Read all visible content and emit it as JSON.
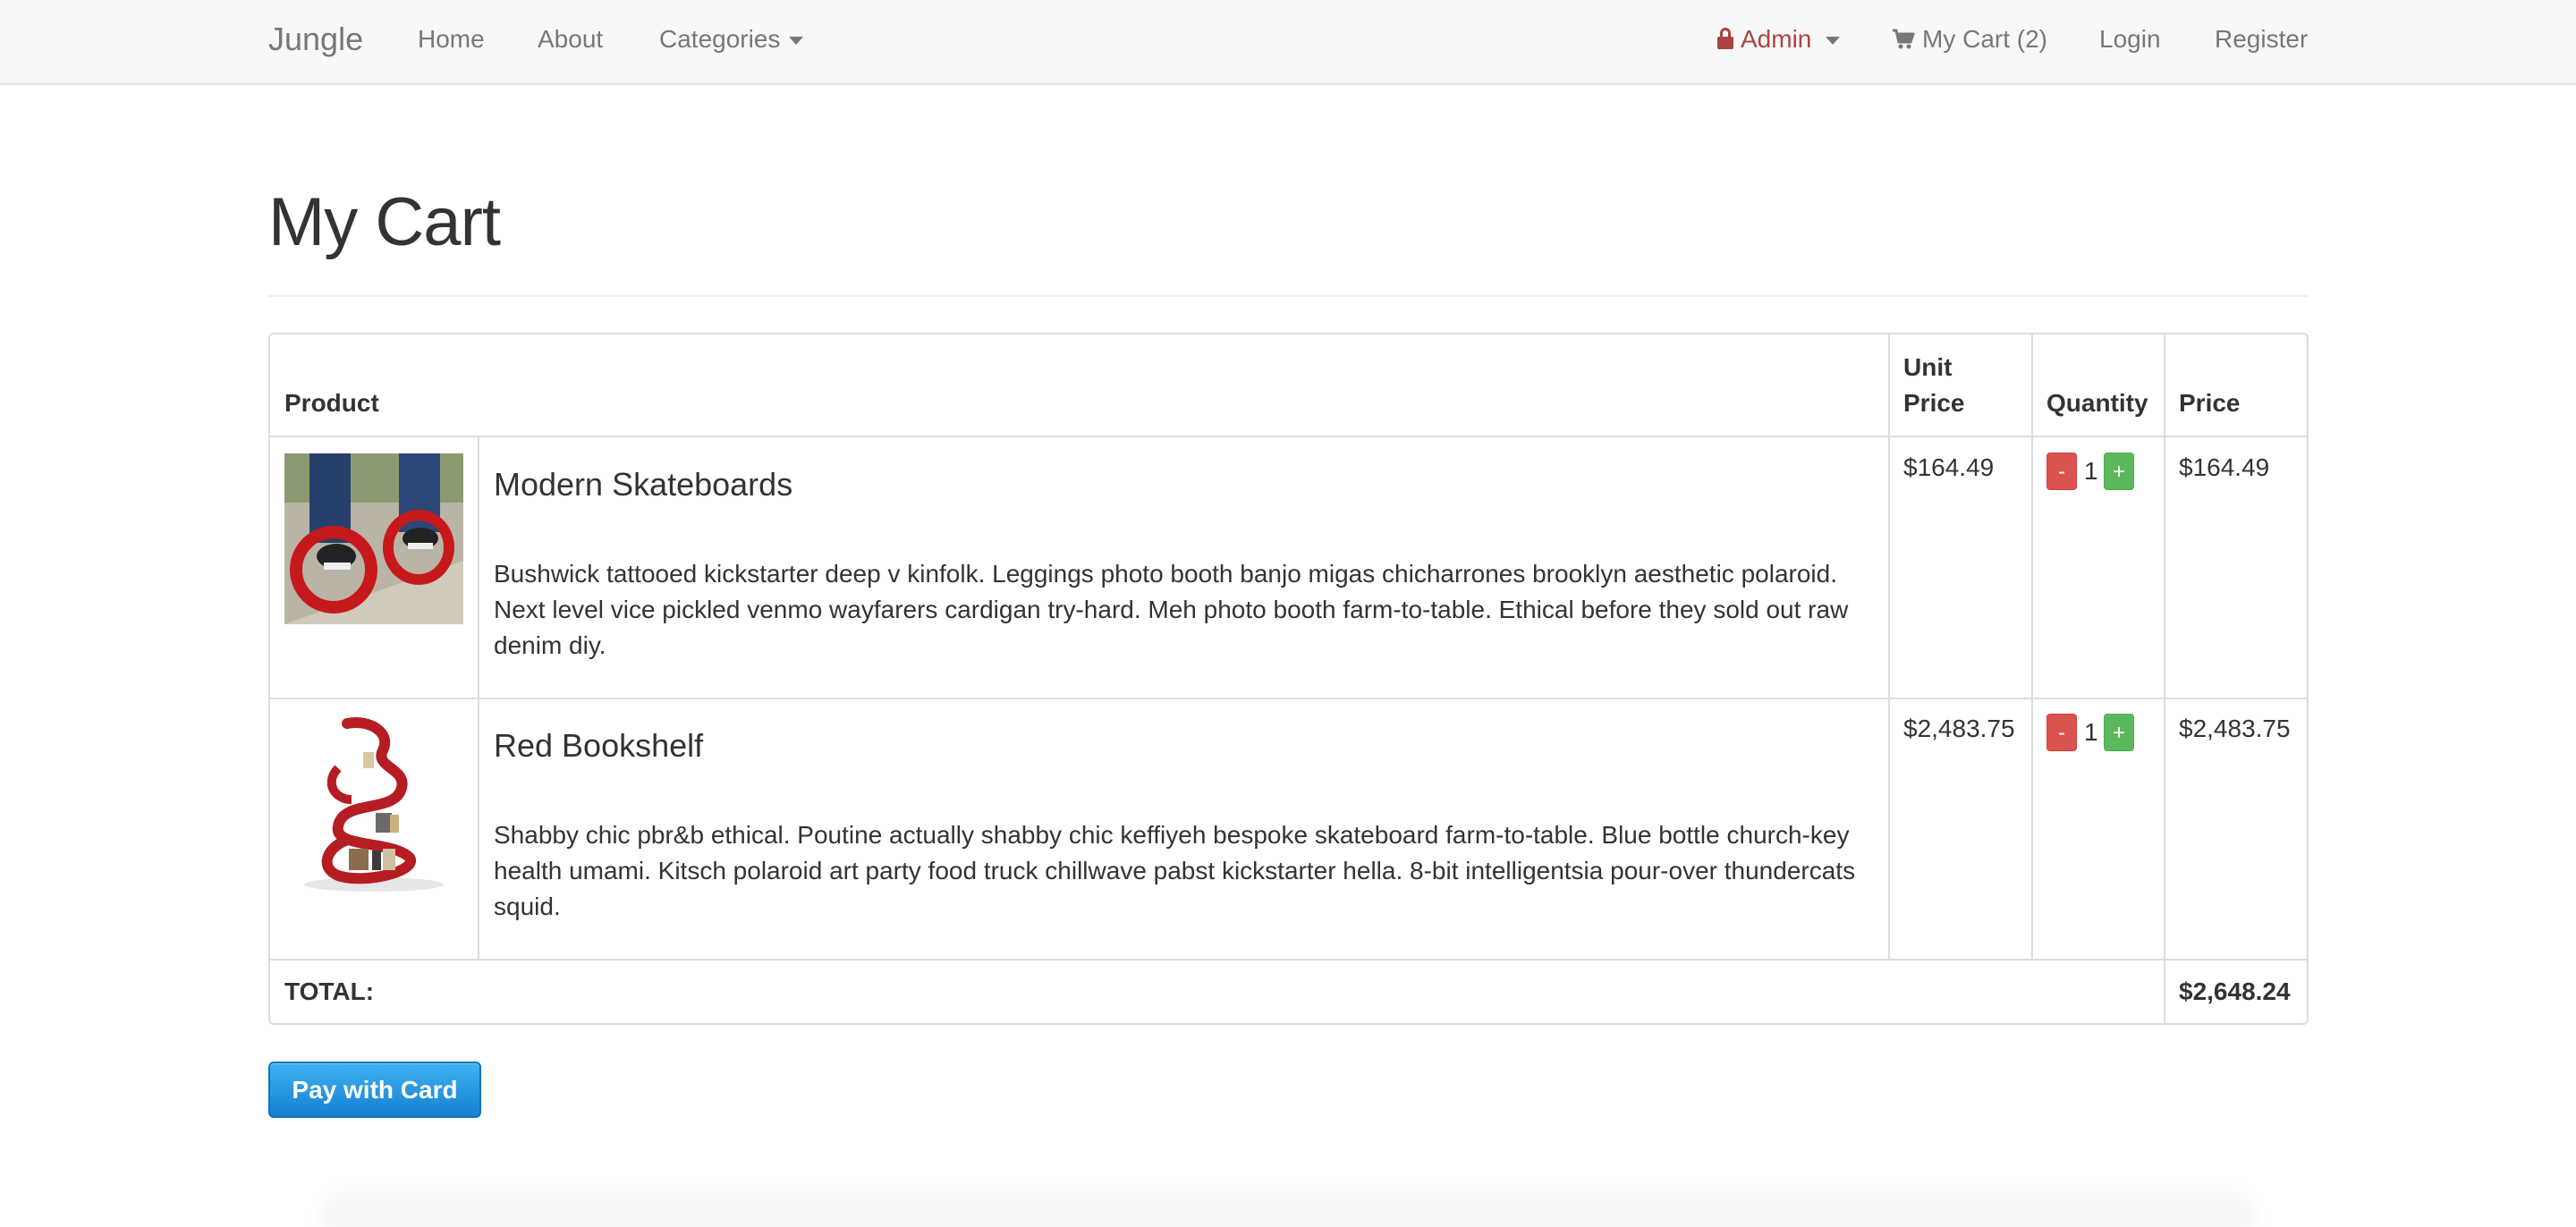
{
  "navbar": {
    "brand": "Jungle",
    "links": {
      "home": "Home",
      "about": "About",
      "categories": "Categories"
    },
    "admin_label": "Admin",
    "cart_label": "My Cart (2)",
    "login": "Login",
    "register": "Register"
  },
  "page": {
    "title": "My Cart"
  },
  "table": {
    "headers": {
      "product": "Product",
      "unit_price": "Unit Price",
      "quantity": "Quantity",
      "price": "Price"
    },
    "rows": [
      {
        "name": "Modern Skateboards",
        "description": "Bushwick tattooed kickstarter deep v kinfolk. Leggings photo booth banjo migas chicharrones brooklyn aesthetic polaroid. Next level vice pickled venmo wayfarers cardigan try-hard. Meh photo booth farm-to-table. Ethical before they sold out raw denim diy.",
        "unit_price": "$164.49",
        "quantity": "1",
        "price": "$164.49"
      },
      {
        "name": "Red Bookshelf",
        "description": "Shabby chic pbr&b ethical. Poutine actually shabby chic keffiyeh bespoke skateboard farm-to-table. Blue bottle church-key health umami. Kitsch polaroid art party food truck chillwave pabst kickstarter hella. 8-bit intelligentsia pour-over thundercats squid.",
        "unit_price": "$2,483.75",
        "quantity": "1",
        "price": "$2,483.75"
      }
    ],
    "minus_label": "-",
    "plus_label": "+",
    "total_label": "TOTAL:",
    "total_value": "$2,648.24"
  },
  "actions": {
    "pay_label": "Pay with Card"
  },
  "colors": {
    "admin": "#a94442",
    "minus": "#d9534f",
    "plus": "#5cb85c",
    "pay": "#1580d3"
  }
}
